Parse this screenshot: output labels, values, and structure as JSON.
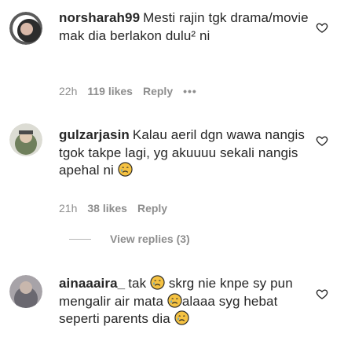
{
  "comments": [
    {
      "username": "norsharah99",
      "text": "Mesti rajin tgk drama/movie mak dia berlakon dulu² ni",
      "time": "22h",
      "likes": "119 likes",
      "reply": "Reply",
      "more": "•••",
      "avatar_color": "#c9c9c9"
    },
    {
      "username": "gulzarjasin",
      "text": "Kalau aeril dgn wawa nangis tgok takpe lagi, yg akuuuu sekali nangis apehal ni",
      "time": "21h",
      "likes": "38 likes",
      "reply": "Reply",
      "avatar_color": "#8a9a7a"
    },
    {
      "username": "ainaaaira_",
      "text_1": "tak",
      "text_2": "skrg nie knpe sy pun mengalir air mata",
      "text_3": "alaaa syg hebat seperti parents dia",
      "avatar_color": "#7a7a82"
    }
  ],
  "view_replies": "View replies (3)",
  "icons": {
    "heart": "heart-outline-icon",
    "crying_emoji": "crying-face-emoji",
    "more": "more-dots-icon"
  },
  "colors": {
    "text": "#262626",
    "secondary": "#8e8e8e",
    "emoji": "#f5c242"
  }
}
